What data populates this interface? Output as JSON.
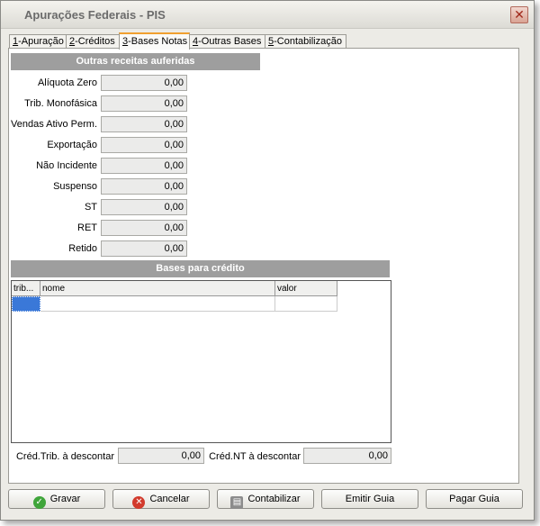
{
  "window": {
    "title": "Apurações Federais - PIS",
    "close_glyph": "✕"
  },
  "tabs": [
    {
      "key": "1",
      "rest": "-Apuração"
    },
    {
      "key": "2",
      "rest": "-Créditos"
    },
    {
      "key": "3",
      "rest": "-Bases Notas"
    },
    {
      "key": "4",
      "rest": "-Outras Bases"
    },
    {
      "key": "5",
      "rest": "-Contabilização"
    }
  ],
  "outras_receitas": {
    "title": "Outras receitas auferidas",
    "rows": [
      {
        "label": "Alíquota Zero",
        "value": "0,00"
      },
      {
        "label": "Trib. Monofásica",
        "value": "0,00"
      },
      {
        "label": "Vendas Ativo Perm.",
        "value": "0,00"
      },
      {
        "label": "Exportação",
        "value": "0,00"
      },
      {
        "label": "Não Incidente",
        "value": "0,00"
      },
      {
        "label": "Suspenso",
        "value": "0,00"
      },
      {
        "label": "ST",
        "value": "0,00"
      },
      {
        "label": "RET",
        "value": "0,00"
      },
      {
        "label": "Retido",
        "value": "0,00"
      }
    ]
  },
  "bases_credito": {
    "title": "Bases para crédito",
    "columns": [
      "trib...",
      "nome",
      "valor"
    ]
  },
  "totals": {
    "cred_trib_label": "Créd.Trib. à descontar",
    "cred_trib_value": "0,00",
    "cred_nt_label": "Créd.NT à descontar",
    "cred_nt_value": "0,00"
  },
  "buttons": {
    "gravar": "Gravar",
    "cancelar": "Cancelar",
    "contabilizar": "Contabilizar",
    "emitir_guia": "Emitir Guia",
    "pagar_guia": "Pagar Guia"
  },
  "colors": {
    "section_header": "#9e9e9e",
    "active_tab_accent": "#f0a030",
    "selected_cell": "#3a78d8"
  }
}
